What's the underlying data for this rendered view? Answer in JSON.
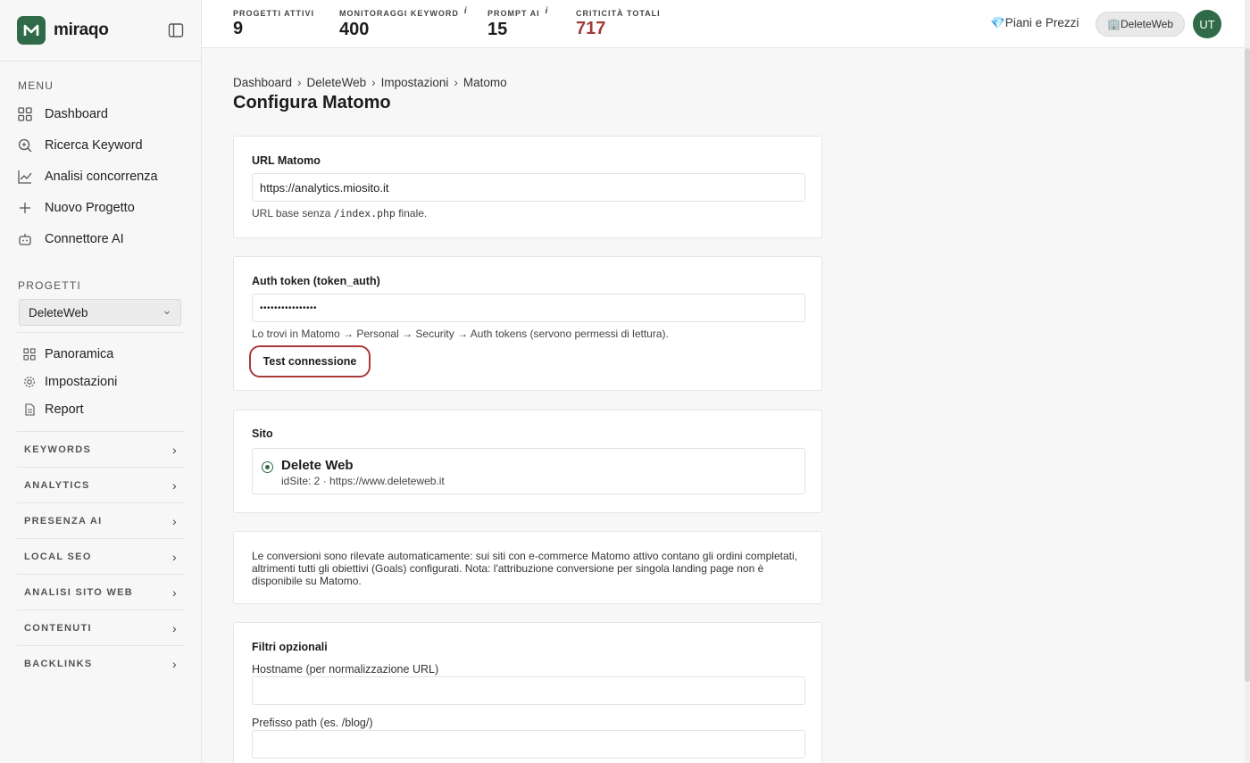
{
  "brand": {
    "name": "miraqo"
  },
  "sidebar": {
    "menu_label": "MENU",
    "menu": [
      {
        "label": "Dashboard",
        "icon": "grid-icon"
      },
      {
        "label": "Ricerca Keyword",
        "icon": "search-plus-icon"
      },
      {
        "label": "Analisi concorrenza",
        "icon": "chart-line-icon"
      },
      {
        "label": "Nuovo Progetto",
        "icon": "plus-icon"
      },
      {
        "label": "Connettore AI",
        "icon": "robot-icon"
      }
    ],
    "projects_label": "PROGETTI",
    "project_selected": "DeleteWeb",
    "project_nav": [
      {
        "label": "Panoramica",
        "icon": "grid-icon"
      },
      {
        "label": "Impostazioni",
        "icon": "gear-icon"
      },
      {
        "label": "Report",
        "icon": "document-icon"
      }
    ],
    "groups": [
      "KEYWORDS",
      "ANALYTICS",
      "PRESENZA AI",
      "LOCAL SEO",
      "ANALISI SITO WEB",
      "CONTENUTI",
      "BACKLINKS"
    ]
  },
  "topbar": {
    "stats": [
      {
        "label": "PROGETTI ATTIVI",
        "value": "9",
        "info": ""
      },
      {
        "label": "MONITORAGGI KEYWORD",
        "value": "400",
        "info": "i"
      },
      {
        "label": "PROMPT AI",
        "value": "15",
        "info": "i"
      },
      {
        "label": "CRITICITÀ TOTALI",
        "value": "717",
        "info": ""
      }
    ],
    "pricing": "💎Piani e Prezzi",
    "workspace": "🏢DeleteWeb",
    "avatar": "UT",
    "critical_color": "#a33b3b"
  },
  "breadcrumb": [
    "Dashboard",
    "DeleteWeb",
    "Impostazioni",
    "Matomo"
  ],
  "page_title": "Configura Matomo",
  "url_card": {
    "label": "URL Matomo",
    "value": "https://analytics.miosito.it",
    "help_prefix": "URL base senza",
    "help_code": "/index.php",
    "help_suffix": "finale."
  },
  "token_card": {
    "label": "Auth token (token_auth)",
    "value": "••••••••••••••••",
    "help": "Lo trovi in Matomo → Personal → Security → Auth tokens (servono permessi di lettura).",
    "test_button": "Test connessione"
  },
  "site_card": {
    "label": "Sito",
    "site_name": "Delete Web",
    "site_meta": "idSite: 2 · https://www.deleteweb.it"
  },
  "conversion_note": "Le conversioni sono rilevate automaticamente: sui siti con e-commerce Matomo attivo contano gli ordini completati, altrimenti tutti gli obiettivi (Goals) configurati. Nota: l'attribuzione conversione per singola landing page non è disponibile su Matomo.",
  "filters_card": {
    "title": "Filtri opzionali",
    "hostname_label": "Hostname (per normalizzazione URL)",
    "hostname_value": "",
    "path_label": "Prefisso path (es. /blog/)",
    "path_value": ""
  },
  "colors": {
    "brand": "#2f6b48",
    "accent_red": "#a83a3a"
  }
}
